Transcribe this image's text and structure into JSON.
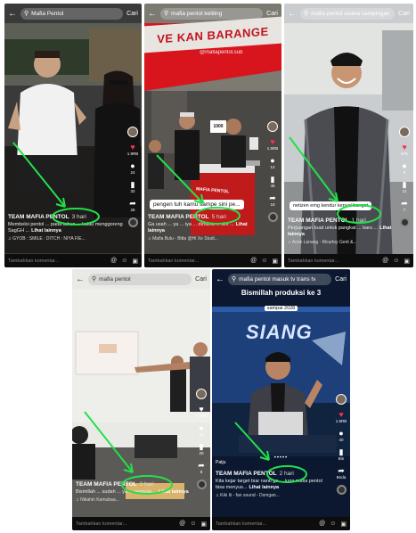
{
  "colors": {
    "annotation": "#22e04a",
    "tiktok_red": "#ff2d55"
  },
  "panels": [
    {
      "search": {
        "query": "Mafia Pentol",
        "button": "Cari"
      },
      "caption": {
        "author": "TEAM MAFIA PENTOL",
        "time": "3 hari",
        "desc": "Membeloi pentol ... pada tahun ... kalau menggoreng SagGH ...",
        "more": "Lihat lainnya",
        "music": "♫ GYOB : SMILE : DITCH : NIYA FIE..."
      },
      "rail": {
        "likes": "1.9RB",
        "comments": "24",
        "saves": "32",
        "shares": "25"
      },
      "comment_placeholder": "Tambahkan komentar..."
    },
    {
      "search": {
        "query": "mafia pentol keliling",
        "button": "Cari"
      },
      "banner": "VE KAN BARANGE",
      "watermark": "@mafiapentol.sub",
      "price": "1000",
      "cart_text": "MAFIA PENTOL",
      "bubble": "pengen tuh kamu sampe sini pe...",
      "caption": {
        "author": "TEAM MAFIA PENTOL",
        "time": "5 hari",
        "desc": "Ga usah ... ya ... iya ... dimana ... sini ...",
        "more": "Lihat lainnya",
        "music": "♫ Mafia Bulu - Bitta @Hi Xe Studi..."
      },
      "rail": {
        "likes": "1.5RB",
        "comments": "12",
        "saves": "45",
        "shares": "18"
      },
      "comment_placeholder": "Tambahkan komentar..."
    },
    {
      "search": {
        "query": "mafia pentol usaha sampingan",
        "button": "Cari"
      },
      "bubble": "netizen emg kendur kenyal banget",
      "caption": {
        "author": "TEAM MAFIA PENTOL",
        "time": "1 hari",
        "desc": "Perjuangan buat untuk pangkat ... baru ...",
        "more": "Lihat lainnya",
        "music": "♫ Anak Lanang - Mcurtoy Gerit &..."
      },
      "rail": {
        "likes": "875",
        "comments": "9",
        "saves": "11",
        "shares": "7"
      },
      "comment_placeholder": "Tambahkan komentar..."
    },
    {
      "search": {
        "query": "mafia pentol",
        "button": "Cari"
      },
      "caption": {
        "author": "TEAM MAFIA PENTOL",
        "time": "3 hari",
        "desc": "Bismillah ... sudah ... ya ... pemulai ...",
        "more": "Lihat lainnya",
        "music": "♫ Nikahin Kamubaa..."
      },
      "rail": {
        "likes": "1.2RB",
        "comments": "15",
        "saves": "20",
        "shares": "8"
      },
      "comment_placeholder": "Tambahkan komentar..."
    },
    {
      "search": {
        "query": "mafia pentol masuk tv trans tv",
        "button": "Cari"
      },
      "title": "Bismillah produksi ke 3",
      "subtitle": "sampai 2028",
      "news_text": "SIANG",
      "live": "Patju",
      "caption": {
        "author": "TEAM MAFIA PENTOL",
        "time": "2 hari",
        "desc": "Kita kejar target biar nanti ga ... juga mafia pentol bisa menyus...",
        "more": "Lihat lainnya",
        "music": "♫ Kiki Iii - fan sound - Dsmgan..."
      },
      "rail": {
        "likes": "1.6RB",
        "comments": "40",
        "saves": "Bin",
        "shares": "Bnda"
      },
      "comment_placeholder": "Tambahkan komentar..."
    }
  ]
}
